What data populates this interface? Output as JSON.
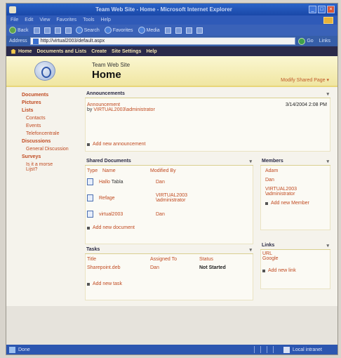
{
  "window": {
    "title": "Team Web Site - Home - Microsoft Internet Explorer"
  },
  "menubar": {
    "items": [
      "File",
      "Edit",
      "View",
      "Favorites",
      "Tools",
      "Help"
    ]
  },
  "toolbar": {
    "back": "Back",
    "search": "Search",
    "favorites": "Favorites",
    "media": "Media"
  },
  "address": {
    "label": "Address",
    "value": "http://virtual2003/default.aspx",
    "go": "Go",
    "links": "Links"
  },
  "topnav": {
    "items": [
      "Home",
      "Documents and Lists",
      "Create",
      "Site Settings",
      "Help"
    ]
  },
  "header": {
    "site": "Team Web Site",
    "page": "Home",
    "modify": "Modify Shared Page ▾"
  },
  "quicklaunch": {
    "documents": "Documents",
    "pictures": "Pictures",
    "lists": "Lists",
    "list_items": [
      "Contacts",
      "Events",
      "Telefoncentrale"
    ],
    "discussions": "Discussions",
    "discussion_items": [
      "General Discussion"
    ],
    "surveys": "Surveys",
    "survey_items": [
      "Is it a morse",
      "Lijst?"
    ]
  },
  "announcements": {
    "title": "Announcements",
    "item_title": "Announcement",
    "item_by_prefix": "by",
    "item_by": "VIRTUAL2003\\administrator",
    "item_date": "3/14/2004 2:08 PM",
    "add": "Add new announcement"
  },
  "shared_documents": {
    "title": "Shared Documents",
    "col_type": "Type",
    "col_name": "Name",
    "col_modified": "Modified By",
    "rows": [
      {
        "name": "Hallo",
        "extra": "Tabla",
        "by": "Dan"
      },
      {
        "name": "Refage",
        "extra": "",
        "by": "VIRTUAL2003 \\administrator"
      },
      {
        "name": "virtual2003",
        "extra": "",
        "by": "Dan"
      }
    ],
    "add": "Add new document"
  },
  "members": {
    "title": "Members",
    "items": [
      "Adam",
      "Dan",
      "VIRTUAL2003 \\administrator"
    ],
    "add": "Add new Member"
  },
  "tasks": {
    "title": "Tasks",
    "col_title": "Title",
    "col_assigned": "Assigned To",
    "col_status": "Status",
    "row_title": "Sharepoint.deb",
    "row_assigned": "Dan",
    "row_status": "Not Started",
    "add": "Add new task"
  },
  "links": {
    "title": "Links",
    "items": [
      "URL",
      "Google"
    ],
    "add": "Add new link"
  },
  "statusbar": {
    "left": "Done",
    "zone": "Local intranet"
  }
}
